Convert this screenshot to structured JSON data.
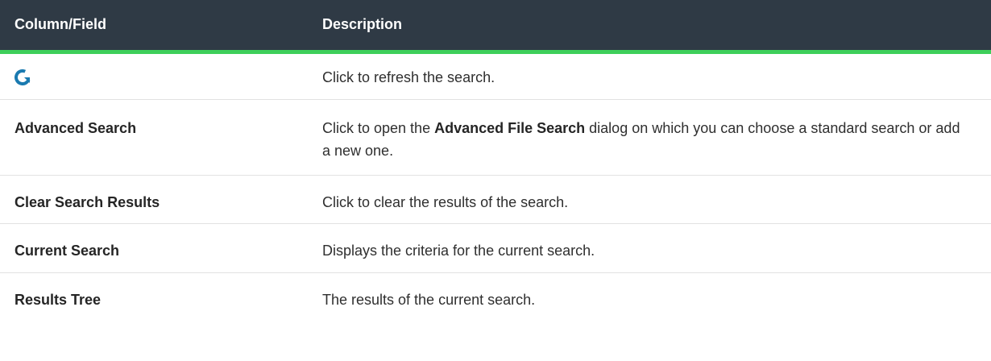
{
  "table": {
    "headers": {
      "field": "Column/Field",
      "description": "Description"
    },
    "rows": [
      {
        "field_icon": "refresh-icon",
        "description": "Click to refresh the search."
      },
      {
        "field": "Advanced Search",
        "description_pre": "Click to open the ",
        "description_bold": "Advanced File Search",
        "description_post": " dialog on which you can choose a standard search or add a new one."
      },
      {
        "field": "Clear Search Results",
        "description": "Click to clear the results of the search."
      },
      {
        "field": "Current Search",
        "description": "Displays the criteria for the current search."
      },
      {
        "field": "Results Tree",
        "description": "The results of the current search."
      }
    ]
  },
  "colors": {
    "header_bg": "#2f3a45",
    "header_rule": "#3ecf5a",
    "icon_blue": "#1a7ab0"
  }
}
